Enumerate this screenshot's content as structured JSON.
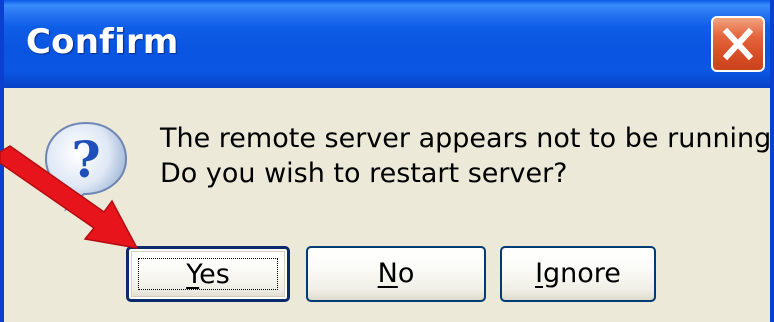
{
  "dialog": {
    "title": "Confirm",
    "close_icon": "close-icon",
    "icon": "question-icon",
    "message_line1": "The remote server appears not to be running",
    "message_line2": "Do you wish to restart server?"
  },
  "buttons": {
    "yes": {
      "pre": "",
      "mnemonic": "Y",
      "post": "es"
    },
    "no": {
      "pre": "",
      "mnemonic": "N",
      "post": "o"
    },
    "ignore": {
      "pre": "",
      "mnemonic": "I",
      "post": "gnore"
    }
  },
  "annotation": {
    "arrow_icon": "red-arrow-icon",
    "arrow_color": "#e8141c"
  },
  "colors": {
    "titlebar": "#0a55e0",
    "dialog_bg": "#ece9d8",
    "close_button": "#d84d25"
  }
}
